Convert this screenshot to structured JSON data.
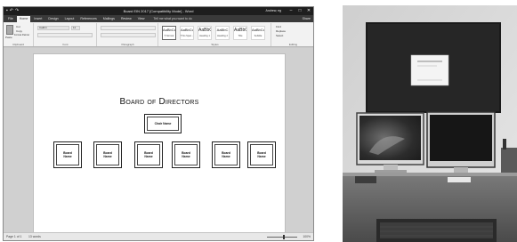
{
  "word_window": {
    "title": "Board EIN 2017 [Compatibility Mode] - Word",
    "user": "Andrew, eg",
    "quick_access": [
      "save-icon",
      "undo-icon",
      "redo-icon"
    ],
    "window_controls": [
      "minimize-icon",
      "maximize-icon",
      "close-icon"
    ],
    "tabs": [
      "File",
      "Home",
      "Insert",
      "Design",
      "Layout",
      "References",
      "Mailings",
      "Review",
      "View"
    ],
    "active_tab": "Home",
    "tell_me": "Tell me what you want to do",
    "share": "Share",
    "ribbon": {
      "clipboard": {
        "label": "Clipboard",
        "paste": "Paste",
        "cut": "Cut",
        "copy": "Copy",
        "format_painter": "Format Painter"
      },
      "font": {
        "label": "Font",
        "font_name": "Calibri",
        "font_size": "11"
      },
      "paragraph": {
        "label": "Paragraph"
      },
      "styles": {
        "label": "Styles",
        "items": [
          {
            "sample": "AaBbCcDc",
            "name": "¶ Normal"
          },
          {
            "sample": "AaBbCcDc",
            "name": "¶ No Spac..."
          },
          {
            "sample": "AaBbC",
            "name": "Heading 1"
          },
          {
            "sample": "AaBbC",
            "name": "Heading 2"
          },
          {
            "sample": "AaBbC",
            "name": "Title"
          },
          {
            "sample": "AaBbCcD",
            "name": "Subtitle"
          }
        ]
      },
      "editing": {
        "label": "Editing",
        "find": "Find",
        "replace": "Replace",
        "select": "Select"
      }
    },
    "document": {
      "heading": "Board of Directors",
      "chair": "Chair Name",
      "members": [
        "Board\nName",
        "Board\nName",
        "Board\nName",
        "Board\nName",
        "Board\nName",
        "Board\nName"
      ]
    },
    "status": {
      "page": "Page 1 of 1",
      "words": "13 words",
      "zoom": "100%"
    }
  },
  "colors": {
    "titlebar": "#1e1e1e",
    "ribbon": "#f2f2f2",
    "page": "#ffffff",
    "doc_background": "#d0d0d0"
  },
  "photo": {
    "description_icons": [
      "monitor-icon",
      "keyboard-icon",
      "bulletin-board-icon"
    ]
  }
}
